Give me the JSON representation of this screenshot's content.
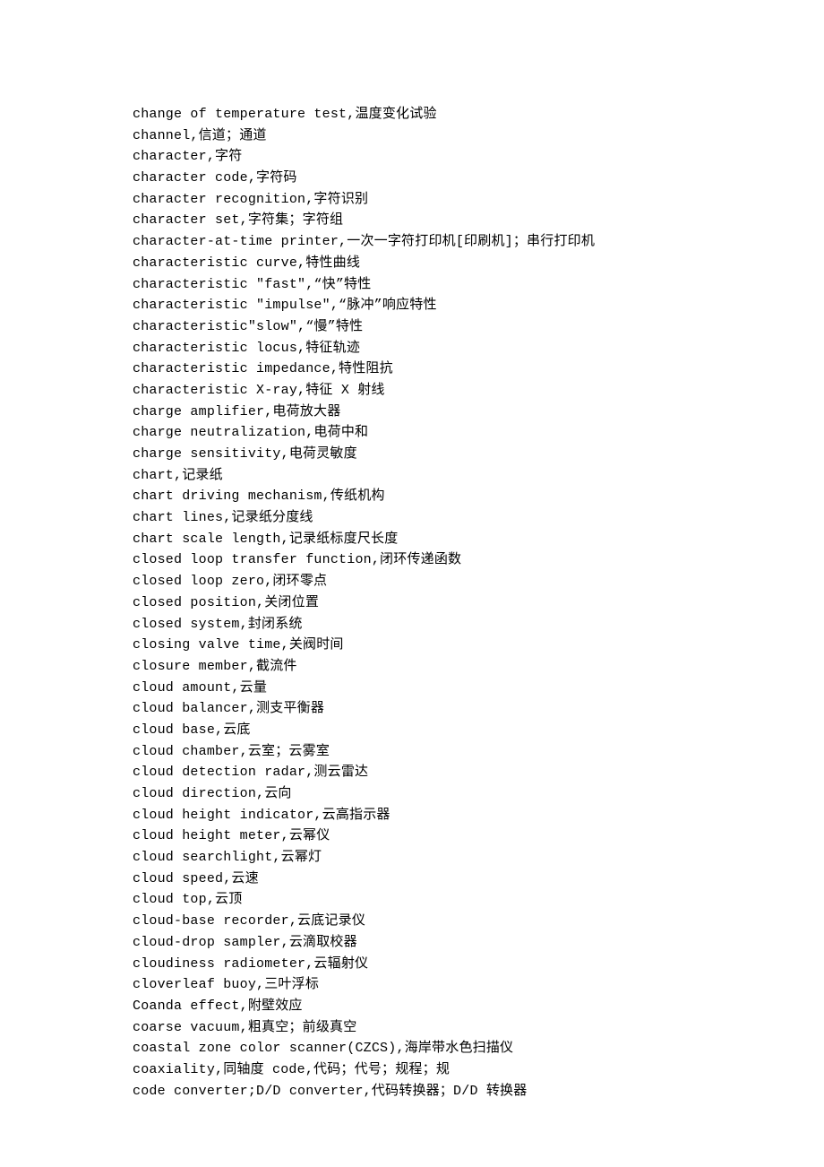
{
  "entries": [
    "change of temperature test,温度变化试验",
    "channel,信道；通道",
    "character,字符",
    "character code,字符码",
    "character recognition,字符识别",
    "character set,字符集；字符组",
    "character-at-time printer,一次一字符打印机[印刷机]；串行打印机",
    "characteristic curve,特性曲线",
    "characteristic \"fast\",“快”特性",
    "characteristic \"impulse\",“脉冲”响应特性",
    "characteristic\"slow\",“慢”特性",
    "characteristic locus,特征轨迹",
    "characteristic impedance,特性阻抗",
    "characteristic X-ray,特征 X 射线",
    "charge amplifier,电荷放大器",
    "charge neutralization,电荷中和",
    "charge sensitivity,电荷灵敏度",
    "chart,记录纸",
    "chart driving mechanism,传纸机构",
    "chart lines,记录纸分度线",
    "chart scale length,记录纸标度尺长度",
    "closed loop transfer function,闭环传递函数",
    "closed loop zero,闭环零点",
    "closed position,关闭位置",
    "closed system,封闭系统",
    "closing valve time,关阀时间",
    "closure member,截流件",
    "cloud amount,云量",
    "cloud balancer,测支平衡器",
    "cloud base,云底",
    "cloud chamber,云室；云雾室",
    "cloud detection radar,测云雷达",
    "cloud direction,云向",
    "cloud height indicator,云高指示器",
    "cloud height meter,云幂仪",
    "cloud searchlight,云幂灯",
    "cloud speed,云速",
    "cloud top,云顶",
    "cloud-base recorder,云底记录仪",
    "cloud-drop sampler,云滴取校器",
    "cloudiness radiometer,云辐射仪",
    "cloverleaf buoy,三叶浮标",
    "Coanda effect,附壁效应",
    "coarse vacuum,粗真空；前级真空",
    "coastal zone color scanner(CZCS),海岸带水色扫描仪",
    "coaxiality,同轴度 code,代码；代号；规程；规",
    "code converter;D/D converter,代码转换器；D/D 转换器"
  ]
}
